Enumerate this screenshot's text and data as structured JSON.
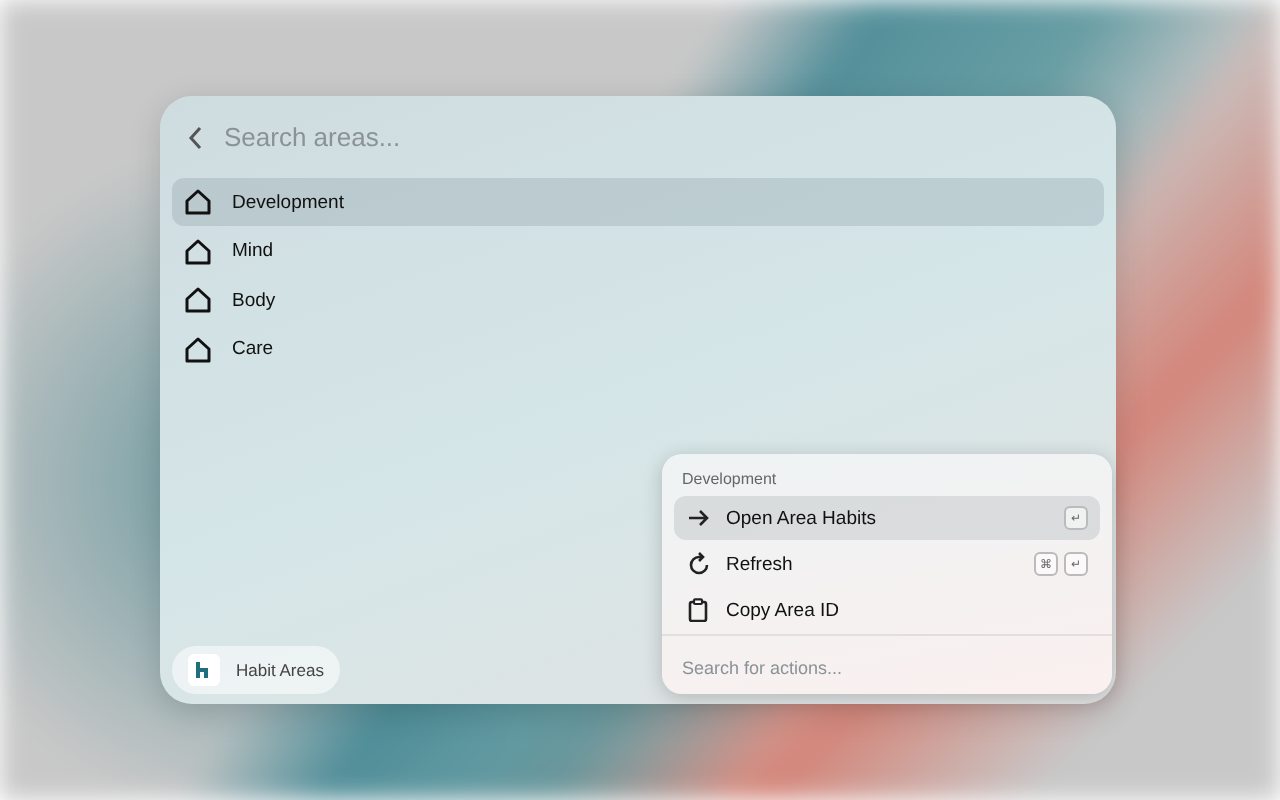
{
  "search": {
    "placeholder": "Search areas..."
  },
  "areas": [
    {
      "label": "Development",
      "selected": true
    },
    {
      "label": "Mind",
      "selected": false
    },
    {
      "label": "Body",
      "selected": false
    },
    {
      "label": "Care",
      "selected": false
    }
  ],
  "footer": {
    "label": "Habit Areas"
  },
  "actions_panel": {
    "title": "Development",
    "actions": [
      {
        "kind": "open",
        "label": "Open Area Habits",
        "selected": true,
        "keys": [
          "↵"
        ]
      },
      {
        "kind": "refresh",
        "label": "Refresh",
        "selected": false,
        "keys": [
          "⌘",
          "↵"
        ]
      },
      {
        "kind": "copy",
        "label": "Copy Area ID",
        "selected": false
      }
    ],
    "search": {
      "placeholder": "Search for actions..."
    }
  }
}
